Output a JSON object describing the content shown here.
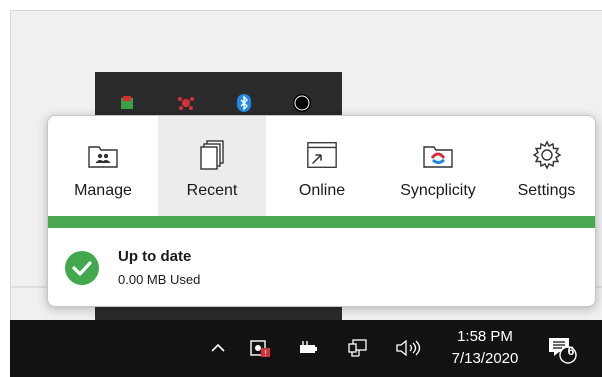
{
  "tabs": [
    {
      "label": "Manage",
      "icon": "manage-folder-icon"
    },
    {
      "label": "Recent",
      "icon": "recent-documents-icon"
    },
    {
      "label": "Online",
      "icon": "online-window-icon"
    },
    {
      "label": "Syncplicity",
      "icon": "syncplicity-folder-icon"
    },
    {
      "label": "Settings",
      "icon": "gear-icon"
    }
  ],
  "active_tab": "Recent",
  "status": {
    "title": "Up to date",
    "usage": "0.00 MB Used"
  },
  "taskbar": {
    "time": "1:58 PM",
    "date": "7/13/2020",
    "notification_count": "6"
  },
  "colors": {
    "accent_green": "#4aa853",
    "taskbar": "#121212",
    "bluetooth": "#1e88e5",
    "red_icon": "#d6303a"
  }
}
